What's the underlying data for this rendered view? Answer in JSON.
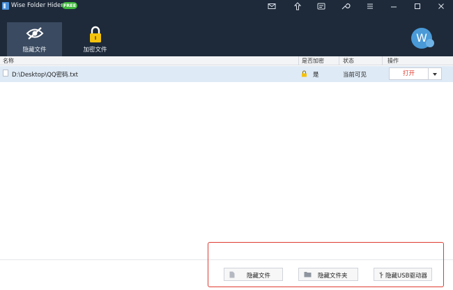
{
  "app": {
    "title": "Wise Folder Hider",
    "badge": "FREE"
  },
  "titlebar_icons": [
    "mail-icon",
    "upgrade-icon",
    "skin-icon",
    "settings-icon",
    "menu-icon",
    "minimize-icon",
    "maximize-icon",
    "close-icon"
  ],
  "tabs": [
    {
      "label": "隐藏文件",
      "icon": "eye-slash-icon",
      "active": true
    },
    {
      "label": "加密文件",
      "icon": "lock-icon",
      "active": false
    }
  ],
  "user": {
    "avatar_letter": "W"
  },
  "table": {
    "headers": {
      "name": "名称",
      "encrypted": "是否加密",
      "state": "状态",
      "action": "操作"
    },
    "rows": [
      {
        "name": "D:\\Desktop\\QQ密码.txt",
        "encrypted": "是",
        "state": "当前可见",
        "action": "打开"
      }
    ]
  },
  "bottom_buttons": {
    "hide_file": "隐藏文件",
    "hide_folder": "隐藏文件夹",
    "hide_usb": "隐藏USB驱动器"
  },
  "colors": {
    "header_bg": "#1e2a3a",
    "active_tab_bg": "#3a4a60",
    "row_selected": "#deeaf6",
    "open_text": "#e23a2e",
    "highlight_frame": "#e03a30",
    "badge_green": "#3fb93c"
  }
}
